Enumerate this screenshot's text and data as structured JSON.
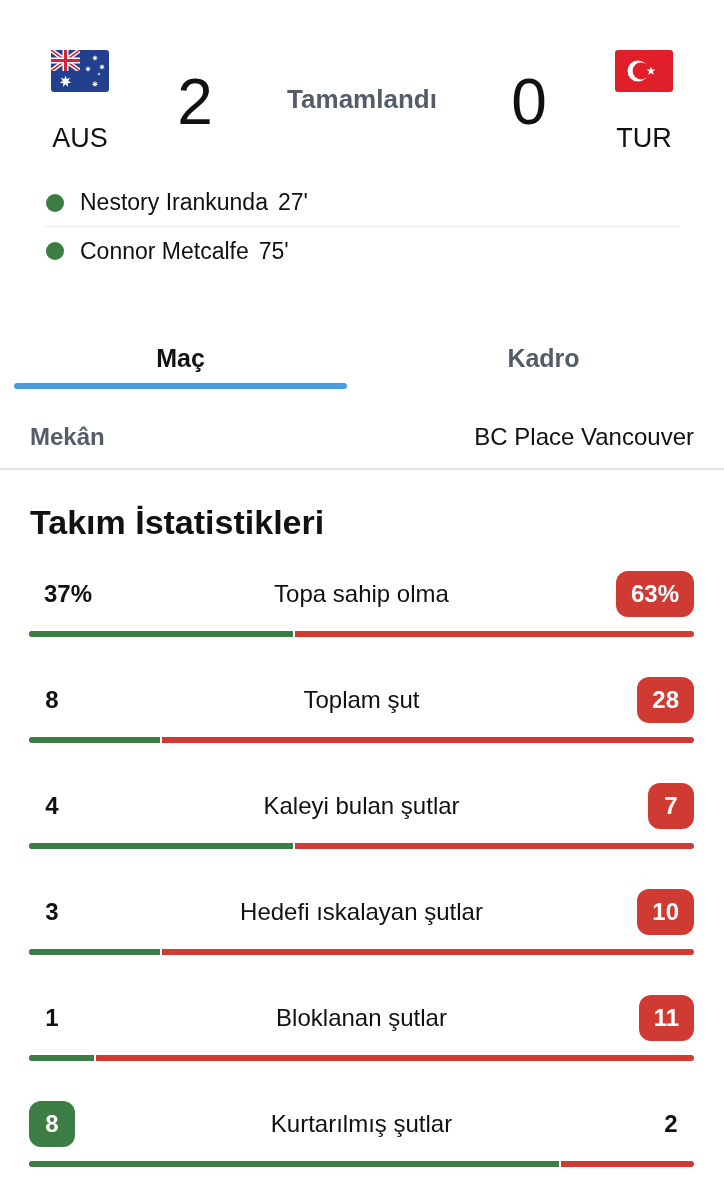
{
  "match": {
    "home": {
      "code": "AUS",
      "score": "2"
    },
    "status": "Tamamlandı",
    "away": {
      "code": "TUR",
      "score": "0"
    }
  },
  "goals": [
    {
      "player": "Nestory Irankunda",
      "minute": "27'"
    },
    {
      "player": "Connor Metcalfe",
      "minute": "75'"
    }
  ],
  "tabs": [
    {
      "label": "Maç",
      "selected": true
    },
    {
      "label": "Kadro",
      "selected": false
    }
  ],
  "venue": {
    "label": "Mekân",
    "value": "BC Place Vancouver"
  },
  "team_stats": {
    "title": "Takım İstatistikleri",
    "rows": [
      {
        "label": "Topa sahip olma",
        "home": {
          "value": "37%",
          "highlighted": false
        },
        "away": {
          "value": "63%",
          "highlighted": true
        },
        "level": 0.4
      },
      {
        "label": "Toplam şut",
        "home": {
          "value": "8",
          "highlighted": false
        },
        "away": {
          "value": "28",
          "highlighted": true
        },
        "level": 0.2
      },
      {
        "label": "Kaleyi bulan şutlar",
        "home": {
          "value": "4",
          "highlighted": false
        },
        "away": {
          "value": "7",
          "highlighted": true
        },
        "level": 0.4
      },
      {
        "label": "Hedefi ıskalayan şutlar",
        "home": {
          "value": "3",
          "highlighted": false
        },
        "away": {
          "value": "10",
          "highlighted": true
        },
        "level": 0.2
      },
      {
        "label": "Bloklanan şutlar",
        "home": {
          "value": "1",
          "highlighted": false
        },
        "away": {
          "value": "11",
          "highlighted": true
        },
        "level": 0.1
      },
      {
        "label": "Kurtarılmış şutlar",
        "home": {
          "value": "8",
          "highlighted": true
        },
        "away": {
          "value": "2",
          "highlighted": false
        },
        "level": 0.8
      }
    ]
  }
}
